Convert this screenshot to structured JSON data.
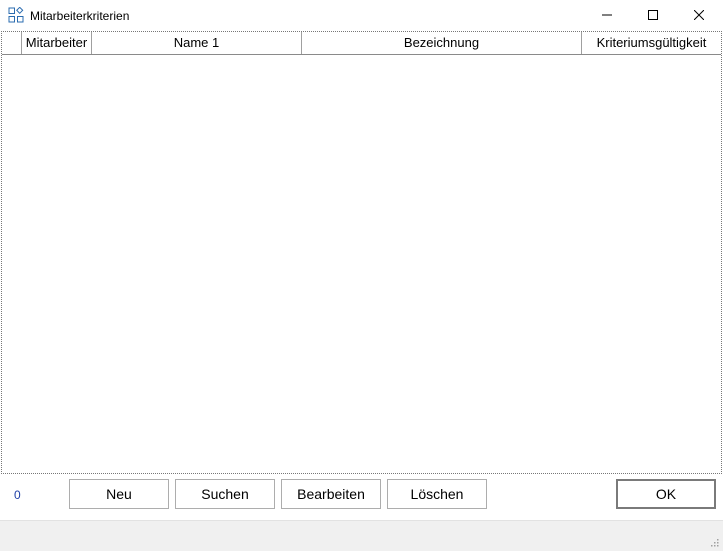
{
  "window": {
    "title": "Mitarbeiterkriterien",
    "icons": {
      "app": "app-grid-icon",
      "minimize": "minimize-icon",
      "maximize": "maximize-icon",
      "close": "close-icon"
    }
  },
  "grid": {
    "columns": [
      "Mitarbeiter",
      "Name 1",
      "Bezeichnung",
      "Kriteriumsgültigkeit"
    ],
    "rows": []
  },
  "footer": {
    "count": "0",
    "buttons": {
      "new": "Neu",
      "search": "Suchen",
      "edit": "Bearbeiten",
      "delete": "Löschen",
      "ok": "OK"
    }
  },
  "colors": {
    "count_text": "#1f3fa6",
    "statusbar_bg": "#f0f0f0",
    "icon_blue": "#2b6cb0"
  }
}
